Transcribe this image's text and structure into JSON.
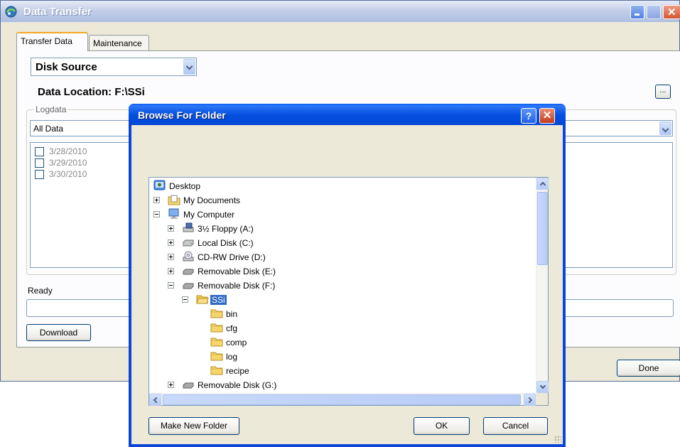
{
  "main_window": {
    "title": "Data Transfer",
    "tabs": [
      {
        "label": "Transfer Data",
        "active": true
      },
      {
        "label": "Maintenance",
        "active": false
      }
    ],
    "source_select": {
      "value": "Disk Source"
    },
    "data_location": "Data Location: F:\\SSi",
    "browse_button": "...",
    "logdata": {
      "legend": "Logdata",
      "filter_value": "All Data",
      "dates": [
        {
          "label": "3/28/2010",
          "checked": false
        },
        {
          "label": "3/29/2010",
          "checked": false
        },
        {
          "label": "3/30/2010",
          "checked": false
        }
      ]
    },
    "status": "Ready",
    "status_value": "",
    "download_button": "Download",
    "done_button": "Done"
  },
  "dialog": {
    "title": "Browse For Folder",
    "help_button": "?",
    "close_button": "✕",
    "tree": [
      {
        "label": "Desktop",
        "icon": "desktop-icon",
        "level": 0,
        "expander": "none"
      },
      {
        "label": "My Documents",
        "icon": "folder-documents-icon",
        "level": 1,
        "expander": "plus"
      },
      {
        "label": "My Computer",
        "icon": "computer-icon",
        "level": 1,
        "expander": "minus"
      },
      {
        "label": "3½ Floppy (A:)",
        "icon": "floppy-drive-icon",
        "level": 2,
        "expander": "plus"
      },
      {
        "label": "Local Disk (C:)",
        "icon": "hard-disk-icon",
        "level": 2,
        "expander": "plus"
      },
      {
        "label": "CD-RW Drive (D:)",
        "icon": "cd-drive-icon",
        "level": 2,
        "expander": "plus"
      },
      {
        "label": "Removable Disk (E:)",
        "icon": "removable-disk-icon",
        "level": 2,
        "expander": "plus"
      },
      {
        "label": "Removable Disk (F:)",
        "icon": "removable-disk-icon",
        "level": 2,
        "expander": "minus"
      },
      {
        "label": "SSi",
        "icon": "folder-open-icon",
        "level": 3,
        "expander": "minus",
        "selected": true
      },
      {
        "label": "bin",
        "icon": "folder-icon",
        "level": 4,
        "expander": "none"
      },
      {
        "label": "cfg",
        "icon": "folder-icon",
        "level": 4,
        "expander": "none"
      },
      {
        "label": "comp",
        "icon": "folder-icon",
        "level": 4,
        "expander": "none"
      },
      {
        "label": "log",
        "icon": "folder-icon",
        "level": 4,
        "expander": "none"
      },
      {
        "label": "recipe",
        "icon": "folder-icon",
        "level": 4,
        "expander": "none"
      },
      {
        "label": "Removable Disk (G:)",
        "icon": "removable-disk-icon",
        "level": 2,
        "expander": "plus"
      }
    ],
    "make_new_folder_button": "Make New Folder",
    "ok_button": "OK",
    "cancel_button": "Cancel"
  },
  "colors": {
    "window_face": "#ece9d8",
    "dialog_titlebar": "#0650e0",
    "selection": "#316ac5"
  }
}
